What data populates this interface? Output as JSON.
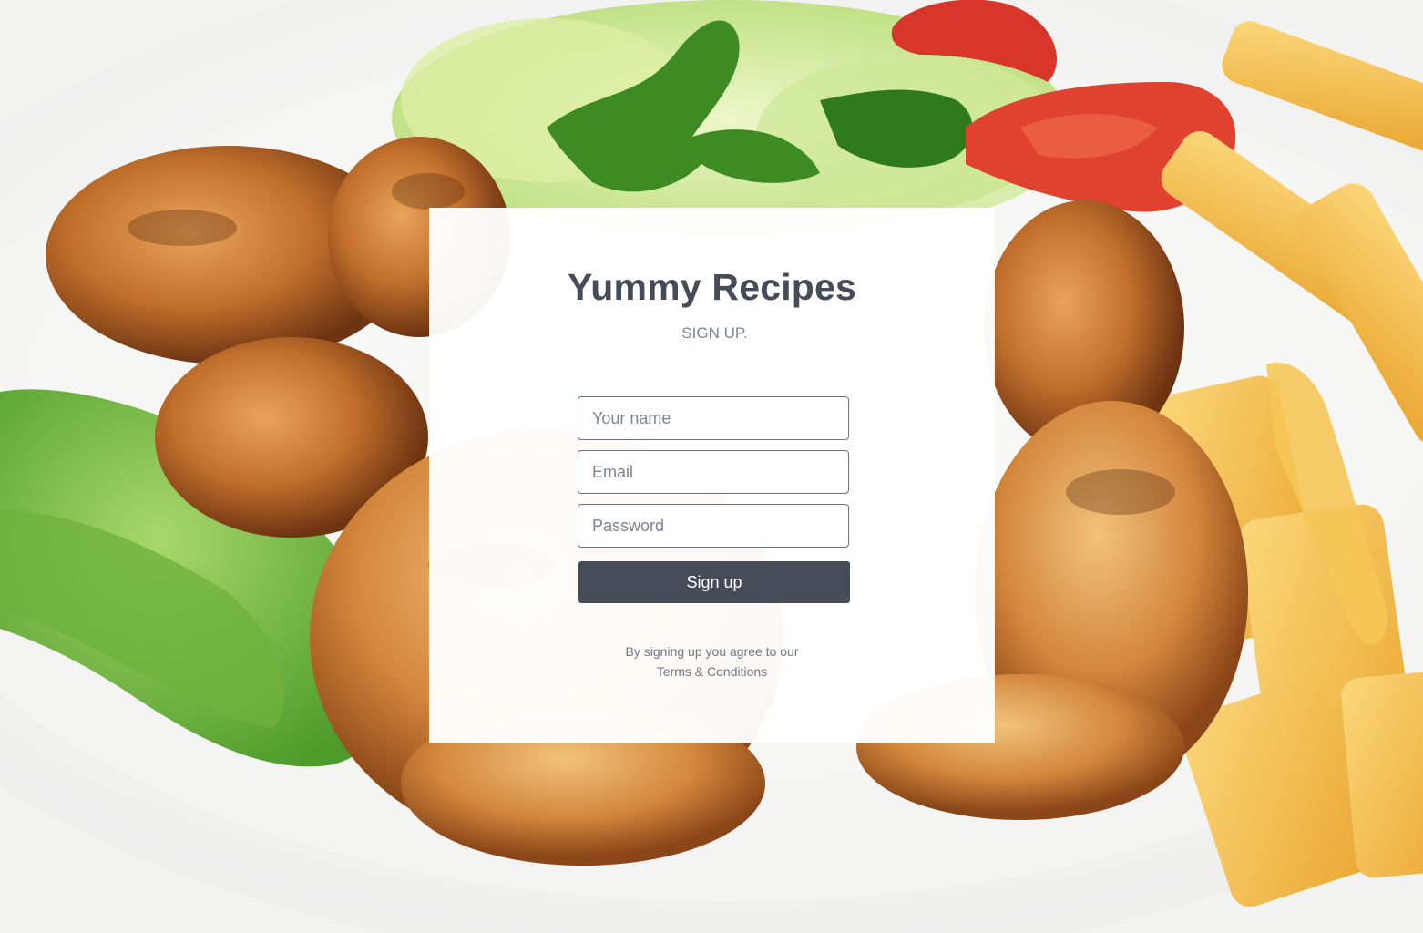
{
  "brand": {
    "title": "Yummy Recipes",
    "subtitle": "SIGN UP."
  },
  "form": {
    "name_placeholder": "Your name",
    "email_placeholder": "Email",
    "password_placeholder": "Password",
    "submit_label": "Sign up"
  },
  "footer": {
    "agree_text": "By signing up you agree to our",
    "terms_link": "Terms & Conditions"
  },
  "colors": {
    "primary": "#454c57",
    "muted": "#7d8591",
    "card_bg": "#ffffff"
  },
  "background": {
    "image": "food-plate-photo"
  }
}
